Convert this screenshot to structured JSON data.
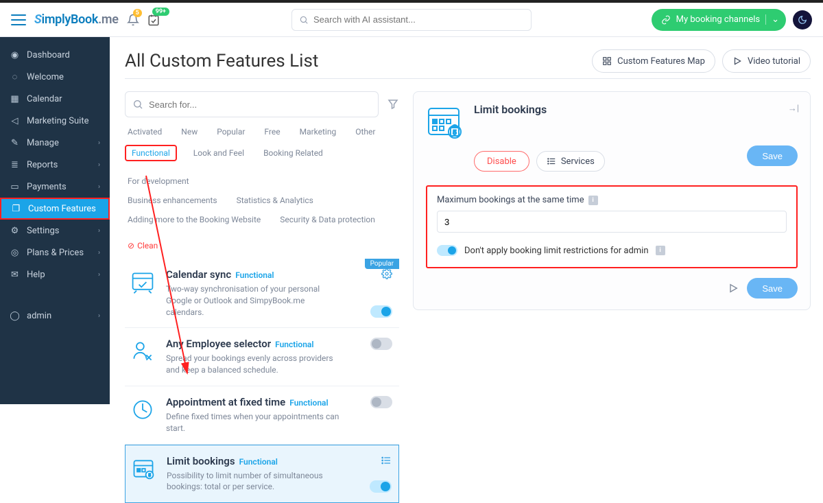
{
  "topbar": {
    "logo_text": "SimplyBook.me",
    "bell_badge": "5",
    "check_badge": "99+",
    "search_placeholder": "Search with AI assistant...",
    "channels_label": "My booking channels"
  },
  "sidebar": {
    "items": [
      {
        "icon": "gauge",
        "label": "Dashboard"
      },
      {
        "icon": "bulb",
        "label": "Welcome"
      },
      {
        "icon": "cal",
        "label": "Calendar"
      },
      {
        "icon": "mega",
        "label": "Marketing Suite"
      },
      {
        "icon": "pencil",
        "label": "Manage",
        "chev": true
      },
      {
        "icon": "bars",
        "label": "Reports",
        "chev": true
      },
      {
        "icon": "card",
        "label": "Payments",
        "chev": true
      },
      {
        "icon": "gift",
        "label": "Custom Features",
        "active": true
      },
      {
        "icon": "gear",
        "label": "Settings",
        "chev": true
      },
      {
        "icon": "coin",
        "label": "Plans & Prices",
        "chev": true
      },
      {
        "icon": "chat",
        "label": "Help",
        "chev": true
      }
    ],
    "footer": {
      "icon": "user",
      "label": "admin",
      "chev": true
    }
  },
  "page": {
    "title": "All Custom Features List",
    "map_btn": "Custom Features Map",
    "video_btn": "Video tutorial",
    "search_placeholder": "Search for..."
  },
  "filters": {
    "row1": [
      "Activated",
      "New",
      "Popular",
      "Free",
      "Marketing",
      "Other"
    ],
    "row2": [
      "Functional",
      "Look and Feel",
      "Booking Related",
      "For development"
    ],
    "row3": [
      "Business enhancements",
      "Statistics & Analytics"
    ],
    "row4": [
      "Adding more to the Booking Website",
      "Security & Data protection"
    ],
    "clean": "Clean",
    "active_filter": "Functional"
  },
  "features": [
    {
      "title": "Calendar sync",
      "tag": "Functional",
      "desc": "Two-way synchronisation of your personal Google or Outlook and SimpyBook.me calendars.",
      "popular": true,
      "on": true,
      "gear": true
    },
    {
      "title": "Any Employee selector",
      "tag": "Functional",
      "desc": "Spread your bookings evenly across providers and keep a balanced schedule.",
      "on": false
    },
    {
      "title": "Appointment at fixed time",
      "tag": "Functional",
      "desc": "Define fixed times when your appointments can start.",
      "on": false
    },
    {
      "title": "Limit bookings",
      "tag": "Functional",
      "desc": "Possibility to limit number of simultaneous bookings: total or per service.",
      "on": true,
      "selected": true,
      "list": true
    }
  ],
  "detail": {
    "title": "Limit bookings",
    "disable": "Disable",
    "services": "Services",
    "save": "Save",
    "field_label": "Maximum bookings at the same time",
    "field_value": "3",
    "checkbox_label": "Don't apply booking limit restrictions for admin"
  }
}
